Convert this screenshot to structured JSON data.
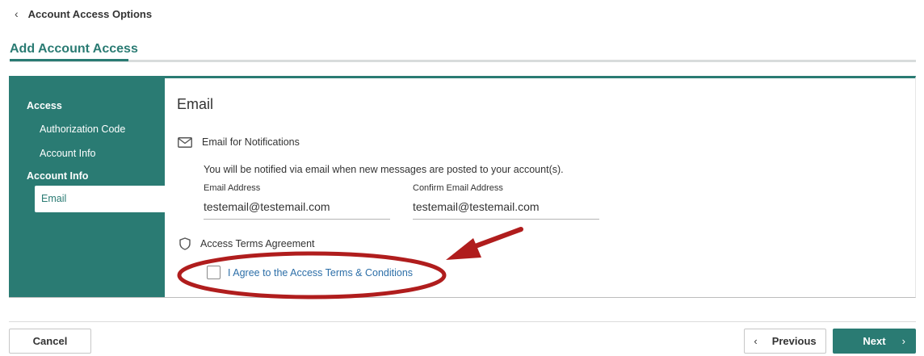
{
  "breadcrumb": {
    "chevron": "‹",
    "label": "Account Access Options"
  },
  "page_title": "Add Account Access",
  "sidebar": {
    "group1": "Access",
    "item_authorization": "Authorization Code",
    "item_account_info": "Account Info",
    "group2": "Account Info",
    "active_item": "Email"
  },
  "content": {
    "section_title": "Email",
    "email_notifications": {
      "icon": "envelope-icon",
      "label": "Email for Notifications"
    },
    "description": "You will be notified via email when new messages are posted to your account(s).",
    "email_field": {
      "label": "Email Address",
      "value": "testemail@testemail.com"
    },
    "confirm_field": {
      "label": "Confirm Email Address",
      "value": "testemail@testemail.com"
    },
    "terms": {
      "icon": "shield-icon",
      "label": "Access Terms Agreement"
    },
    "agree_checkbox": {
      "checked": false,
      "label": "I Agree to the Access Terms & Conditions"
    }
  },
  "footer": {
    "cancel_label": "Cancel",
    "previous_label": "Previous",
    "previous_icon": "‹",
    "next_label": "Next",
    "next_icon": "›"
  },
  "colors": {
    "accent": "#2a7b73",
    "link": "#2d6fa8",
    "annotation_red": "#b01d1d"
  }
}
